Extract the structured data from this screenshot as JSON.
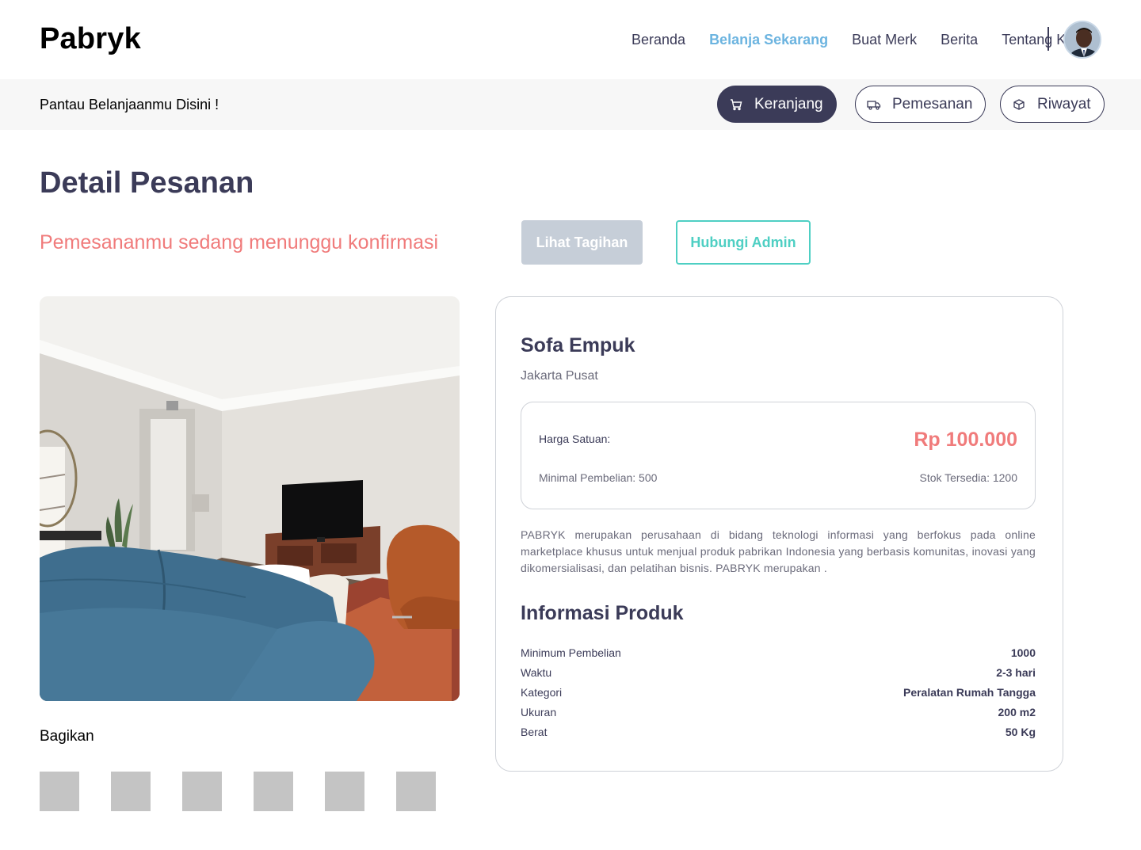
{
  "header": {
    "logo": "Pabryk",
    "nav": [
      "Beranda",
      "Belanja Sekarang",
      "Buat Merk",
      "Berita",
      "Tentang Kami"
    ],
    "active_nav": "Belanja Sekarang"
  },
  "subbar": {
    "text": "Pantau Belanjaanmu Disini !",
    "buttons": {
      "cart": "Keranjang",
      "orders": "Pemesanan",
      "history": "Riwayat"
    }
  },
  "main": {
    "title": "Detail Pesanan",
    "status": "Pemesananmu sedang menunggu konfirmasi",
    "view_invoice": "Lihat Tagihan",
    "contact_admin": "Hubungi Admin",
    "share_label": "Bagikan"
  },
  "product": {
    "name": "Sofa Empuk",
    "location": "Jakarta Pusat",
    "price_label": "Harga Satuan:",
    "price": "Rp 100.000",
    "min_purchase": "Minimal Pembelian: 500",
    "stock": "Stok Tersedia: 1200",
    "description": "PABRYK merupakan perusahaan di bidang teknologi informasi yang berfokus pada online marketplace khusus untuk menjual produk pabrikan Indonesia yang berbasis komunitas, inovasi yang dikomersialisasi, dan pelatihan bisnis. PABRYK merupakan .",
    "info_title": "Informasi Produk",
    "info": [
      {
        "label": "Minimum Pembelian",
        "value": "1000"
      },
      {
        "label": "Waktu",
        "value": "2-3 hari"
      },
      {
        "label": "Kategori",
        "value": "Peralatan Rumah Tangga"
      },
      {
        "label": "Ukuran",
        "value": "200 m2"
      },
      {
        "label": "Berat",
        "value": "50 Kg"
      }
    ]
  },
  "colors": {
    "primary": "#3b3b58",
    "accent_blue": "#6cb4e0",
    "alert": "#f07b7b",
    "teal": "#4ecfc3",
    "disabled": "#c6ced8"
  }
}
